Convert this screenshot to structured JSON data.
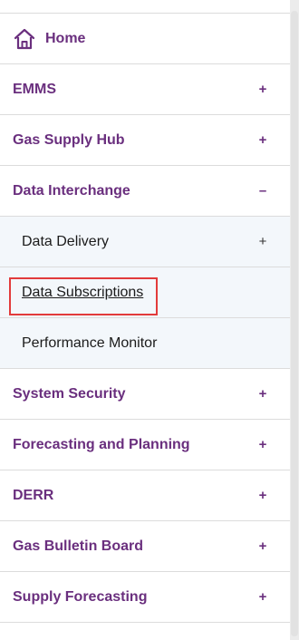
{
  "nav": {
    "home": {
      "label": "Home",
      "icon": "home-icon"
    },
    "items": [
      {
        "label": "EMMS",
        "toggle": "+"
      },
      {
        "label": "Gas Supply Hub",
        "toggle": "+"
      },
      {
        "label": "Data Interchange",
        "toggle": "–"
      }
    ],
    "subitems": [
      {
        "label": "Data Delivery",
        "toggle": "+"
      },
      {
        "label": "Data Subscriptions"
      },
      {
        "label": "Performance Monitor"
      }
    ],
    "items_after": [
      {
        "label": "System Security",
        "toggle": "+"
      },
      {
        "label": "Forecasting and Planning",
        "toggle": "+"
      },
      {
        "label": "DERR",
        "toggle": "+"
      },
      {
        "label": "Gas Bulletin Board",
        "toggle": "+"
      },
      {
        "label": "Supply Forecasting",
        "toggle": "+"
      }
    ]
  },
  "colors": {
    "accent": "#6a2f7e",
    "highlight": "#e23b3b",
    "sub_bg": "#f3f7fb"
  }
}
